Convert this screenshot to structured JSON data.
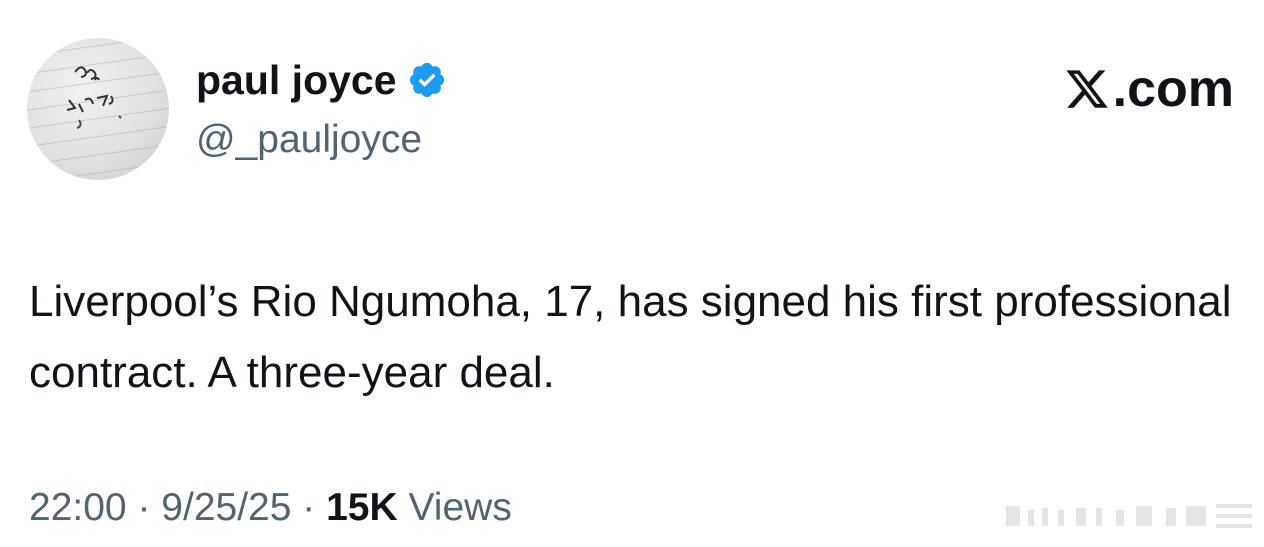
{
  "author": {
    "display_name": "paul joyce",
    "handle": "@_pauljoyce",
    "verified": true,
    "avatar": "handwritten-note-avatar"
  },
  "brand": {
    "label": ".com",
    "icon": "x-logo-icon"
  },
  "tweet": {
    "text": "Liverpool’s Rio Ngumoha, 17, has signed his first professional contract. A three-year deal."
  },
  "meta": {
    "time": "22:00",
    "separator": "·",
    "date": "9/25/25",
    "views_count": "15K",
    "views_label": "Views"
  },
  "colors": {
    "text_primary": "#0f1419",
    "text_secondary": "#536471",
    "verified_blue": "#1d9bf0"
  }
}
